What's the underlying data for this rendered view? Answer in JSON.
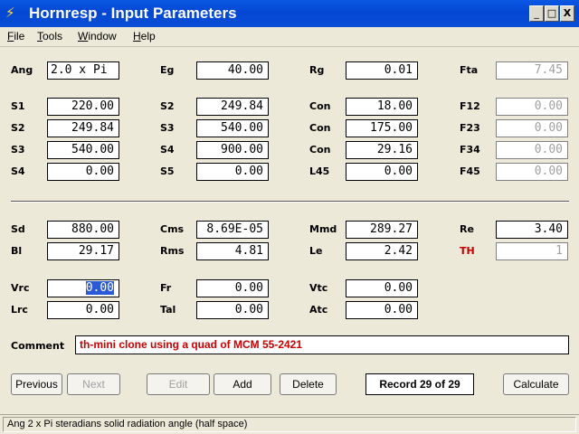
{
  "window": {
    "title": "Hornresp - Input Parameters",
    "controls": {
      "minimize": "_",
      "maximize": "□",
      "close": "X"
    }
  },
  "menu": [
    {
      "u": "F",
      "rest": "ile"
    },
    {
      "u": "T",
      "rest": "ools"
    },
    {
      "u": "W",
      "rest": "indow"
    },
    {
      "u": "H",
      "rest": "elp"
    }
  ],
  "params": {
    "ang": {
      "label": "Ang",
      "value": "2.0 x Pi"
    },
    "eg": {
      "label": "Eg",
      "value": "40.00"
    },
    "rg": {
      "label": "Rg",
      "value": "0.01"
    },
    "fta": {
      "label": "Fta",
      "value": "7.45"
    },
    "s1": {
      "label": "S1",
      "value": "220.00"
    },
    "s2a": {
      "label": "S2",
      "value": "249.84"
    },
    "con1": {
      "label": "Con",
      "value": "18.00"
    },
    "f12": {
      "label": "F12",
      "value": "0.00"
    },
    "s2b": {
      "label": "S2",
      "value": "249.84"
    },
    "s3a": {
      "label": "S3",
      "value": "540.00"
    },
    "con2": {
      "label": "Con",
      "value": "175.00"
    },
    "f23": {
      "label": "F23",
      "value": "0.00"
    },
    "s3b": {
      "label": "S3",
      "value": "540.00"
    },
    "s4a": {
      "label": "S4",
      "value": "900.00"
    },
    "con3": {
      "label": "Con",
      "value": "29.16"
    },
    "f34": {
      "label": "F34",
      "value": "0.00"
    },
    "s4b": {
      "label": "S4",
      "value": "0.00"
    },
    "s5": {
      "label": "S5",
      "value": "0.00"
    },
    "l45": {
      "label": "L45",
      "value": "0.00"
    },
    "f45": {
      "label": "F45",
      "value": "0.00"
    },
    "sd": {
      "label": "Sd",
      "value": "880.00"
    },
    "cms": {
      "label": "Cms",
      "value": "8.69E-05"
    },
    "mmd": {
      "label": "Mmd",
      "value": "289.27"
    },
    "re": {
      "label": "Re",
      "value": "3.40"
    },
    "bl": {
      "label": "Bl",
      "value": "29.17"
    },
    "rms": {
      "label": "Rms",
      "value": "4.81"
    },
    "le": {
      "label": "Le",
      "value": "2.42"
    },
    "th": {
      "label": "TH",
      "value": "1"
    },
    "vrc": {
      "label": "Vrc",
      "value": "0.00"
    },
    "fr": {
      "label": "Fr",
      "value": "0.00"
    },
    "vtc": {
      "label": "Vtc",
      "value": "0.00"
    },
    "lrc": {
      "label": "Lrc",
      "value": "0.00"
    },
    "tal": {
      "label": "Tal",
      "value": "0.00"
    },
    "atc": {
      "label": "Atc",
      "value": "0.00"
    }
  },
  "comment": {
    "label": "Comment",
    "value": "th-mini clone using a quad of MCM 55-2421"
  },
  "buttons": {
    "previous": "Previous",
    "next": "Next",
    "edit": "Edit",
    "add": "Add",
    "delete": "Delete",
    "calculate": "Calculate"
  },
  "record": "Record 29 of 29",
  "status": "Ang   2 x Pi steradians solid radiation angle  (half space)",
  "colors": {
    "titlebar": "#0346d2",
    "th_label": "#c80000",
    "comment_text": "#c80000",
    "selection": "#2a5ad6"
  }
}
